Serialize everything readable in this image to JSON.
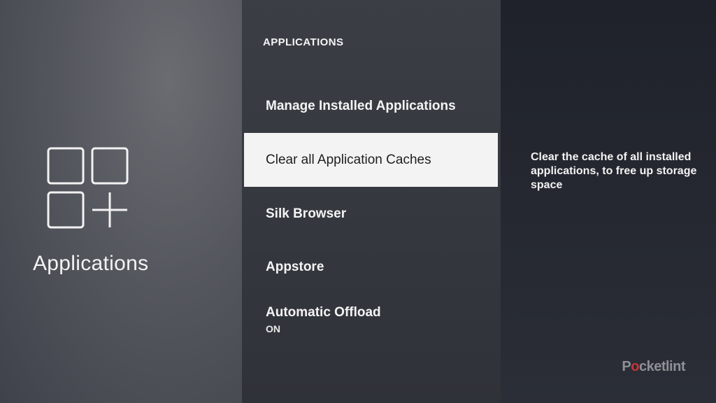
{
  "category": {
    "title": "Applications",
    "icon": "apps-grid-plus-icon"
  },
  "menu": {
    "header": "APPLICATIONS",
    "items": [
      {
        "label": "Manage Installed Applications",
        "sub": ""
      },
      {
        "label": "Clear all Application Caches",
        "sub": "",
        "selected": true
      },
      {
        "label": "Silk Browser",
        "sub": ""
      },
      {
        "label": "Appstore",
        "sub": ""
      },
      {
        "label": "Automatic Offload",
        "sub": "ON"
      }
    ]
  },
  "description": "Clear the cache of all installed applications, to free up storage space",
  "watermark": {
    "pre": "P",
    "mark": "o",
    "post": "cketlint"
  },
  "colors": {
    "selected_bg": "#f3f3f3",
    "watermark_accent": "#c8343a"
  }
}
